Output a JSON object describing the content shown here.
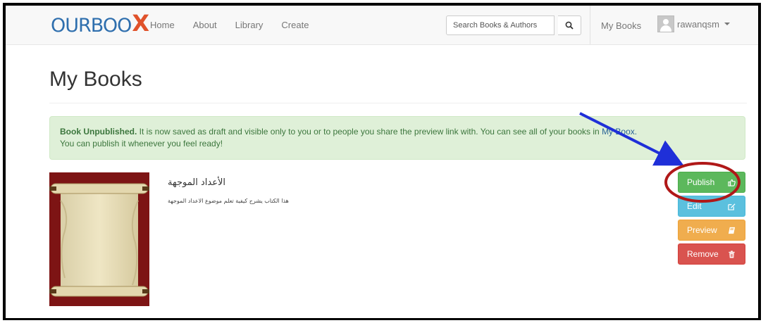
{
  "navbar": {
    "logo_text": "OURBOO",
    "logo_x": "X",
    "links": [
      "Home",
      "About",
      "Library",
      "Create"
    ],
    "search_placeholder": "Search Books & Authors",
    "my_books_link": "My Books",
    "username": "rawanqsm"
  },
  "page": {
    "title": "My Books"
  },
  "alert": {
    "bold": "Book Unpublished.",
    "text": " It is now saved as draft and visible only to you or to people you share the preview link with. You can see all of your books in ",
    "link": "My Boox.",
    "line2": "You can publish it whenever you feel ready!"
  },
  "book": {
    "title": "الأعداد الموجهة",
    "description": "هذا الكتاب يشرح كيفية تعلم موضوع الاعداد الموجهة"
  },
  "actions": {
    "publish": "Publish",
    "edit": "Edit",
    "preview": "Preview",
    "remove": "Remove"
  },
  "colors": {
    "publish": "#5cb85c",
    "edit": "#5bc0de",
    "preview": "#f0ad4e",
    "remove": "#d9534f",
    "annotation_arrow": "#1f2fd8",
    "annotation_circle": "#b01818"
  }
}
